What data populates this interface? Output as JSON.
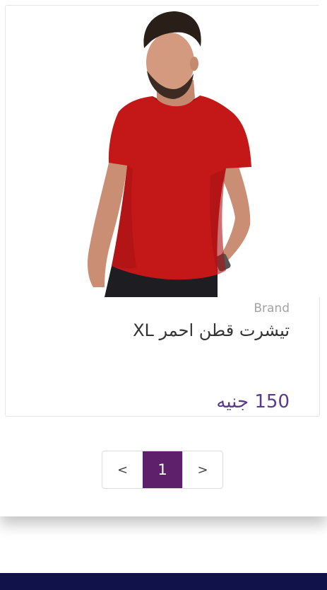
{
  "product": {
    "brand": "Brand",
    "title": "تيشرت قطن احمر XL",
    "price": "150 جنيه"
  },
  "pagination": {
    "prev_label": "<",
    "current_page": "1",
    "next_label": ">"
  },
  "colors": {
    "accent": "#5e1f6b",
    "price_text": "#5a3a8a",
    "footer": "#12124a",
    "shirt": "#c41718"
  },
  "icons": [
    "product-photo"
  ]
}
